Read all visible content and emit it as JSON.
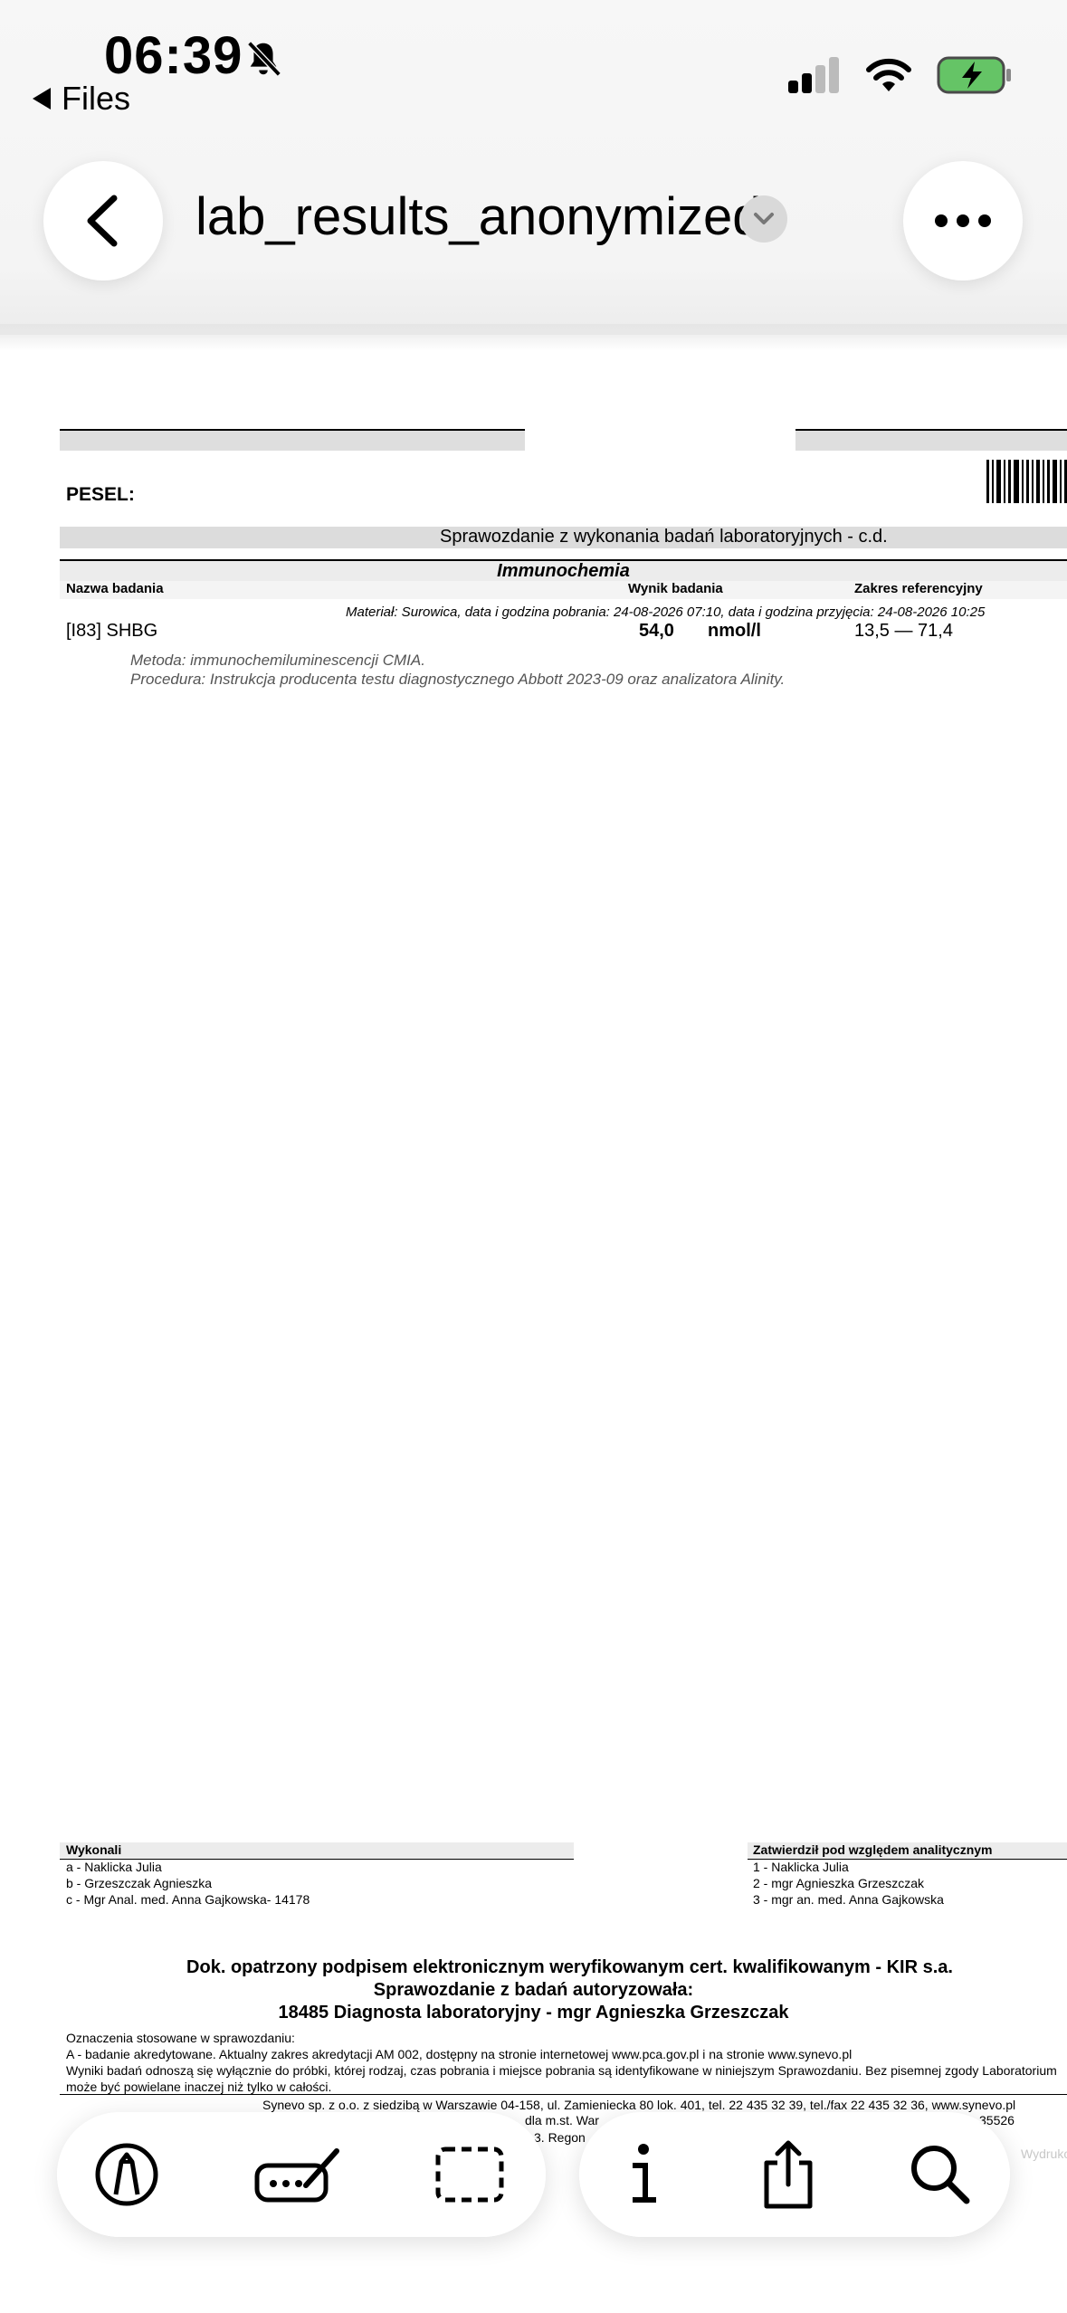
{
  "status_bar": {
    "time": "06:39",
    "back_app": "Files"
  },
  "nav": {
    "title": "lab_results_anonymized"
  },
  "document": {
    "pesel_label": "PESEL:",
    "report_title": "Sprawozdanie z wykonania badań laboratoryjnych - c.d.",
    "section": "Immunochemia",
    "columns": {
      "name": "Nazwa badania",
      "result": "Wynik badania",
      "range": "Zakres referencyjny"
    },
    "material": "Materiał: Surowica, data i godzina pobrania: 24-08-2026 07:10, data i godzina przyjęcia: 24-08-2026 10:25",
    "test": {
      "name": "[I83] SHBG",
      "value": "54,0",
      "unit": "nmol/l",
      "range": "13,5 — 71,4"
    },
    "method": "Metoda: immunochemiluminescencji CMIA.",
    "procedure": "Procedura: Instrukcja producenta testu diagnostycznego Abbott 2023-09 oraz analizatora Alinity.",
    "performed_header": "Wykonali",
    "performed": [
      "a - Naklicka Julia",
      "b - Grzeszczak Agnieszka",
      "c - Mgr Anal. med. Anna Gajkowska- 14178"
    ],
    "approved_header": "Zatwierdził pod względem analitycznym",
    "approved": [
      "1 - Naklicka Julia",
      "2 - mgr Agnieszka Grzeszczak",
      "3 - mgr an. med. Anna Gajkowska"
    ],
    "signature_lines": [
      "Dok. opatrzony podpisem elektronicznym weryfikowanym cert. kwalifikowanym - KIR s.a.",
      "Sprawozdanie z badań autoryzowała:",
      "18485 Diagnosta laboratoryjny - mgr Agnieszka Grzeszczak"
    ],
    "notes": [
      "Oznaczenia stosowane w sprawozdaniu:",
      "A - badanie akredytowane. Aktualny zakres akredytacji AM 002, dostępny na stronie internetowej www.pca.gov.pl i na stronie www.synevo.pl",
      "Wyniki badań odnoszą się wyłącznie do próbki, której rodzaj, czas pobrania i miejsce pobrania są identyfikowane w niniejszym Sprawozdaniu. Bez pisemnej zgody Laboratorium",
      "może być powielane inaczej niż tylko w całości."
    ],
    "footer_address_1": "Synevo sp. z o.o. z siedzibą w Warszawie 04-158, ul. Zamieniecka 80 lok. 401, tel. 22 435 32 39, tel./fax 22 435 32 36, www.synevo.pl",
    "footer_address_2": "dla m.st. War",
    "footer_address_2b": "35526",
    "footer_address_3": "3. Regon",
    "footer_printed": "Wydruko"
  },
  "toolbar": {
    "left_icons": [
      "markup-pen-icon",
      "signature-icon",
      "selection-icon"
    ],
    "right_icons": [
      "info-icon",
      "share-icon",
      "search-icon"
    ]
  }
}
